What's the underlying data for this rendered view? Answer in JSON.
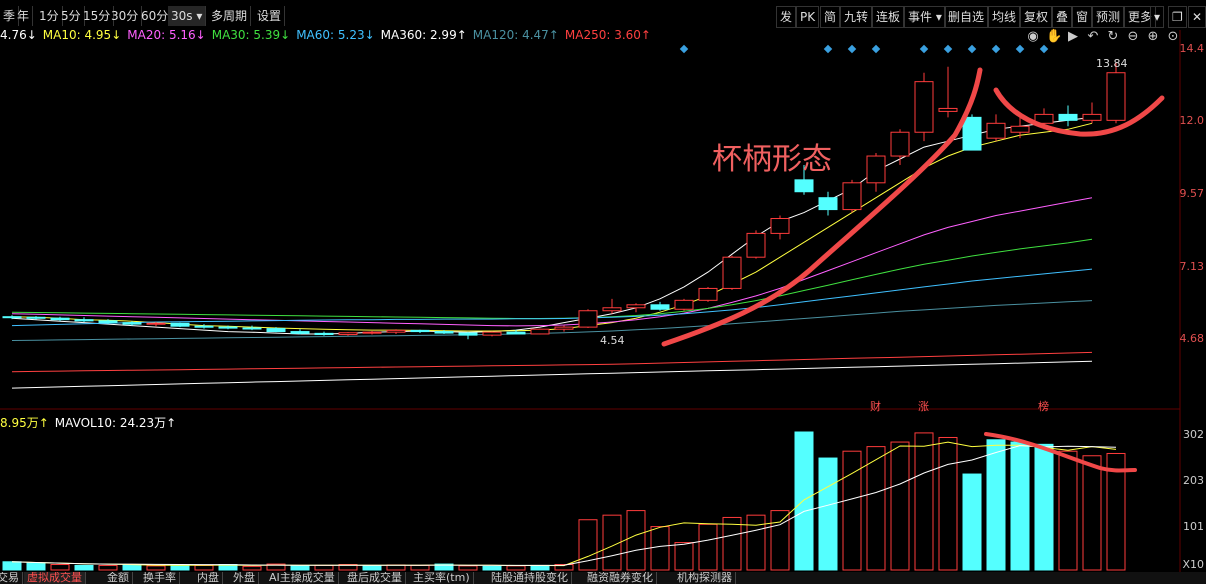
{
  "toolbar": {
    "left": [
      "季",
      "年",
      "1分",
      "5分",
      "15分",
      "30分",
      "60分",
      "30s",
      "多周期",
      "设置"
    ],
    "selected_index": 7,
    "right": [
      "发",
      "PK",
      "简",
      "九转",
      "连板",
      "事件",
      "删自选",
      "均线",
      "复权",
      "叠",
      "窗",
      "预测",
      "更多"
    ]
  },
  "ma_legend": [
    {
      "text": "4.76↓",
      "color": "#ffffff"
    },
    {
      "text": "MA10: 4.95↓",
      "color": "#ffff40"
    },
    {
      "text": "MA20: 5.16↓",
      "color": "#ff60ff"
    },
    {
      "text": "MA30: 5.39↓",
      "color": "#40e040"
    },
    {
      "text": "MA60: 5.23↓",
      "color": "#40c0ff"
    },
    {
      "text": "MA360: 2.99↑",
      "color": "#ffffff"
    },
    {
      "text": "MA120: 4.47↑",
      "color": "#4a90a0"
    },
    {
      "text": "MA250: 3.60↑",
      "color": "#ff4040"
    }
  ],
  "vol_legend": [
    {
      "text": "8.95万↑",
      "color": "#ffff40"
    },
    {
      "text": "MAVOL10: 24.23万↑",
      "color": "#ffffff"
    }
  ],
  "price_axis": [
    "14.4",
    "12.0",
    "9.57",
    "7.13",
    "4.68"
  ],
  "vol_axis": [
    "302",
    "203",
    "101",
    "X10"
  ],
  "annotation": "杯柄形态",
  "high_label": "13.84",
  "low_label": "4.54",
  "event_tags": [
    "财",
    "涨",
    "榜"
  ],
  "bottom_tabs": [
    "交易",
    "虚拟成交量",
    "金额",
    "换手率",
    "内盘",
    "外盘",
    "AI主操成交量",
    "盘后成交量",
    "主买率(tm)",
    "陆股通持股变化",
    "融资融券变化",
    "机构探测器"
  ],
  "bottom_selected": 1,
  "chart_data": {
    "type": "candlestick",
    "candles": [
      [
        5.3,
        5.35,
        5.22,
        5.28
      ],
      [
        5.28,
        5.32,
        5.2,
        5.25
      ],
      [
        5.25,
        5.3,
        5.15,
        5.2
      ],
      [
        5.2,
        5.28,
        5.12,
        5.16
      ],
      [
        5.16,
        5.22,
        5.05,
        5.1
      ],
      [
        5.1,
        5.15,
        5.0,
        5.05
      ],
      [
        5.05,
        5.12,
        4.98,
        5.08
      ],
      [
        5.08,
        5.1,
        4.95,
        4.98
      ],
      [
        4.98,
        5.05,
        4.9,
        4.95
      ],
      [
        4.95,
        5.0,
        4.88,
        4.92
      ],
      [
        4.92,
        5.0,
        4.85,
        4.9
      ],
      [
        4.9,
        4.95,
        4.78,
        4.8
      ],
      [
        4.8,
        4.88,
        4.7,
        4.74
      ],
      [
        4.74,
        4.8,
        4.66,
        4.7
      ],
      [
        4.7,
        4.78,
        4.66,
        4.76
      ],
      [
        4.76,
        4.82,
        4.7,
        4.78
      ],
      [
        4.78,
        4.88,
        4.72,
        4.84
      ],
      [
        4.84,
        4.86,
        4.75,
        4.8
      ],
      [
        4.8,
        4.85,
        4.72,
        4.75
      ],
      [
        4.75,
        4.78,
        4.54,
        4.68
      ],
      [
        4.68,
        4.8,
        4.64,
        4.78
      ],
      [
        4.78,
        4.86,
        4.7,
        4.72
      ],
      [
        4.72,
        4.9,
        4.7,
        4.88
      ],
      [
        4.88,
        5.0,
        4.8,
        4.95
      ],
      [
        4.95,
        5.55,
        4.92,
        5.5
      ],
      [
        5.5,
        5.9,
        5.4,
        5.6
      ],
      [
        5.6,
        5.75,
        5.45,
        5.7
      ],
      [
        5.7,
        5.8,
        5.5,
        5.55
      ],
      [
        5.55,
        5.9,
        5.5,
        5.85
      ],
      [
        5.85,
        6.3,
        5.8,
        6.25
      ],
      [
        6.25,
        7.35,
        6.2,
        7.3
      ],
      [
        7.3,
        8.2,
        7.25,
        8.1
      ],
      [
        8.1,
        8.7,
        7.9,
        8.6
      ],
      [
        9.9,
        10.4,
        9.4,
        9.5
      ],
      [
        9.3,
        9.5,
        8.7,
        8.9
      ],
      [
        8.9,
        9.9,
        8.8,
        9.8
      ],
      [
        9.8,
        10.8,
        9.5,
        10.7
      ],
      [
        10.7,
        11.6,
        10.4,
        11.5
      ],
      [
        11.5,
        13.5,
        11.2,
        13.2
      ],
      [
        12.2,
        13.7,
        12.0,
        12.3
      ],
      [
        12.0,
        12.1,
        10.9,
        10.9
      ],
      [
        11.3,
        12.1,
        11.2,
        11.8
      ],
      [
        11.5,
        12.1,
        11.3,
        11.7
      ],
      [
        11.8,
        12.3,
        11.6,
        12.1
      ],
      [
        12.1,
        12.4,
        11.7,
        11.9
      ],
      [
        11.9,
        12.5,
        11.8,
        12.1
      ],
      [
        11.9,
        13.84,
        11.8,
        13.5
      ]
    ],
    "volumes": [
      18,
      15,
      12,
      10,
      10,
      12,
      9,
      11,
      10,
      12,
      8,
      13,
      9,
      10,
      12,
      9,
      11,
      10,
      13,
      9,
      8,
      9,
      10,
      12,
      110,
      120,
      130,
      95,
      60,
      100,
      115,
      120,
      130,
      302,
      245,
      260,
      270,
      280,
      300,
      290,
      210,
      285,
      280,
      275,
      260,
      250,
      255
    ],
    "vol_down_indices": [
      0,
      1,
      3,
      5,
      7,
      9,
      12,
      15,
      18,
      20,
      22,
      33,
      34,
      40,
      41,
      42,
      43
    ],
    "ma_lines": [
      {
        "color": "#ffffff",
        "values": [
          5.25,
          5.2,
          5.15,
          5.1,
          5.05,
          5.0,
          4.95,
          4.9,
          4.85,
          4.8,
          4.78,
          4.75,
          4.72,
          4.72,
          4.74,
          4.78,
          4.8,
          4.82,
          4.8,
          4.78,
          4.8,
          4.85,
          4.95,
          5.1,
          5.25,
          5.4,
          5.6,
          5.9,
          6.3,
          6.8,
          7.4,
          8.0,
          8.5,
          8.8,
          9.2,
          9.6,
          10.2,
          10.6,
          11.0,
          11.2,
          11.4,
          11.6,
          11.7,
          11.8,
          11.9,
          12.0
        ]
      },
      {
        "color": "#ffff40",
        "values": [
          5.3,
          5.28,
          5.25,
          5.2,
          5.18,
          5.15,
          5.1,
          5.05,
          5.0,
          4.98,
          4.95,
          4.92,
          4.9,
          4.88,
          4.86,
          4.85,
          4.85,
          4.84,
          4.83,
          4.82,
          4.82,
          4.83,
          4.85,
          4.9,
          5.0,
          5.1,
          5.25,
          5.45,
          5.7,
          6.0,
          6.4,
          6.8,
          7.3,
          7.8,
          8.3,
          8.8,
          9.3,
          9.8,
          10.3,
          10.7,
          11.0,
          11.2,
          11.4,
          11.5,
          11.6,
          11.8
        ]
      },
      {
        "color": "#ff60ff",
        "values": [
          5.4,
          5.38,
          5.36,
          5.34,
          5.32,
          5.3,
          5.28,
          5.26,
          5.24,
          5.22,
          5.2,
          5.18,
          5.16,
          5.14,
          5.12,
          5.1,
          5.08,
          5.06,
          5.04,
          5.02,
          5.0,
          4.99,
          5.0,
          5.02,
          5.06,
          5.12,
          5.2,
          5.3,
          5.42,
          5.58,
          5.78,
          6.0,
          6.25,
          6.55,
          6.85,
          7.15,
          7.45,
          7.75,
          8.05,
          8.3,
          8.5,
          8.7,
          8.85,
          9.0,
          9.15,
          9.3
        ]
      },
      {
        "color": "#40e040",
        "values": [
          5.45,
          5.44,
          5.43,
          5.42,
          5.41,
          5.4,
          5.39,
          5.38,
          5.37,
          5.36,
          5.35,
          5.34,
          5.33,
          5.32,
          5.31,
          5.3,
          5.29,
          5.28,
          5.27,
          5.26,
          5.25,
          5.24,
          5.24,
          5.25,
          5.27,
          5.3,
          5.34,
          5.4,
          5.48,
          5.58,
          5.7,
          5.84,
          6.0,
          6.18,
          6.36,
          6.54,
          6.72,
          6.9,
          7.06,
          7.2,
          7.34,
          7.46,
          7.58,
          7.68,
          7.78,
          7.9
        ]
      },
      {
        "color": "#40c0ff",
        "values": [
          5.0,
          5.02,
          5.04,
          5.06,
          5.08,
          5.1,
          5.12,
          5.13,
          5.14,
          5.15,
          5.16,
          5.17,
          5.18,
          5.19,
          5.2,
          5.2,
          5.21,
          5.21,
          5.22,
          5.22,
          5.22,
          5.23,
          5.23,
          5.24,
          5.26,
          5.28,
          5.31,
          5.35,
          5.4,
          5.46,
          5.53,
          5.61,
          5.7,
          5.8,
          5.9,
          6.0,
          6.1,
          6.2,
          6.3,
          6.4,
          6.5,
          6.58,
          6.66,
          6.74,
          6.82,
          6.9
        ]
      },
      {
        "color": "#4a90a0",
        "values": [
          4.5,
          4.51,
          4.52,
          4.53,
          4.54,
          4.55,
          4.56,
          4.57,
          4.58,
          4.59,
          4.6,
          4.61,
          4.62,
          4.63,
          4.64,
          4.65,
          4.66,
          4.67,
          4.68,
          4.69,
          4.7,
          4.72,
          4.74,
          4.76,
          4.79,
          4.82,
          4.86,
          4.9,
          4.95,
          5.0,
          5.06,
          5.12,
          5.18,
          5.24,
          5.3,
          5.36,
          5.42,
          5.48,
          5.53,
          5.58,
          5.63,
          5.68,
          5.72,
          5.76,
          5.8,
          5.84
        ]
      },
      {
        "color": "#ff4040",
        "values": [
          3.45,
          3.46,
          3.47,
          3.48,
          3.49,
          3.5,
          3.51,
          3.52,
          3.53,
          3.54,
          3.55,
          3.56,
          3.57,
          3.58,
          3.59,
          3.6,
          3.61,
          3.62,
          3.63,
          3.64,
          3.65,
          3.66,
          3.67,
          3.68,
          3.69,
          3.7,
          3.72,
          3.74,
          3.76,
          3.78,
          3.8,
          3.82,
          3.84,
          3.86,
          3.88,
          3.9,
          3.92,
          3.94,
          3.96,
          3.98,
          4.0,
          4.02,
          4.04,
          4.06,
          4.08,
          4.1
        ]
      },
      {
        "color": "#ffffff",
        "values": [
          2.9,
          2.92,
          2.94,
          2.96,
          2.98,
          3.0,
          3.02,
          3.04,
          3.06,
          3.08,
          3.1,
          3.12,
          3.14,
          3.16,
          3.18,
          3.2,
          3.22,
          3.24,
          3.26,
          3.28,
          3.3,
          3.32,
          3.34,
          3.36,
          3.38,
          3.4,
          3.42,
          3.44,
          3.46,
          3.48,
          3.5,
          3.52,
          3.54,
          3.56,
          3.58,
          3.6,
          3.62,
          3.64,
          3.66,
          3.68,
          3.7,
          3.72,
          3.74,
          3.76,
          3.78,
          3.8
        ]
      }
    ]
  }
}
